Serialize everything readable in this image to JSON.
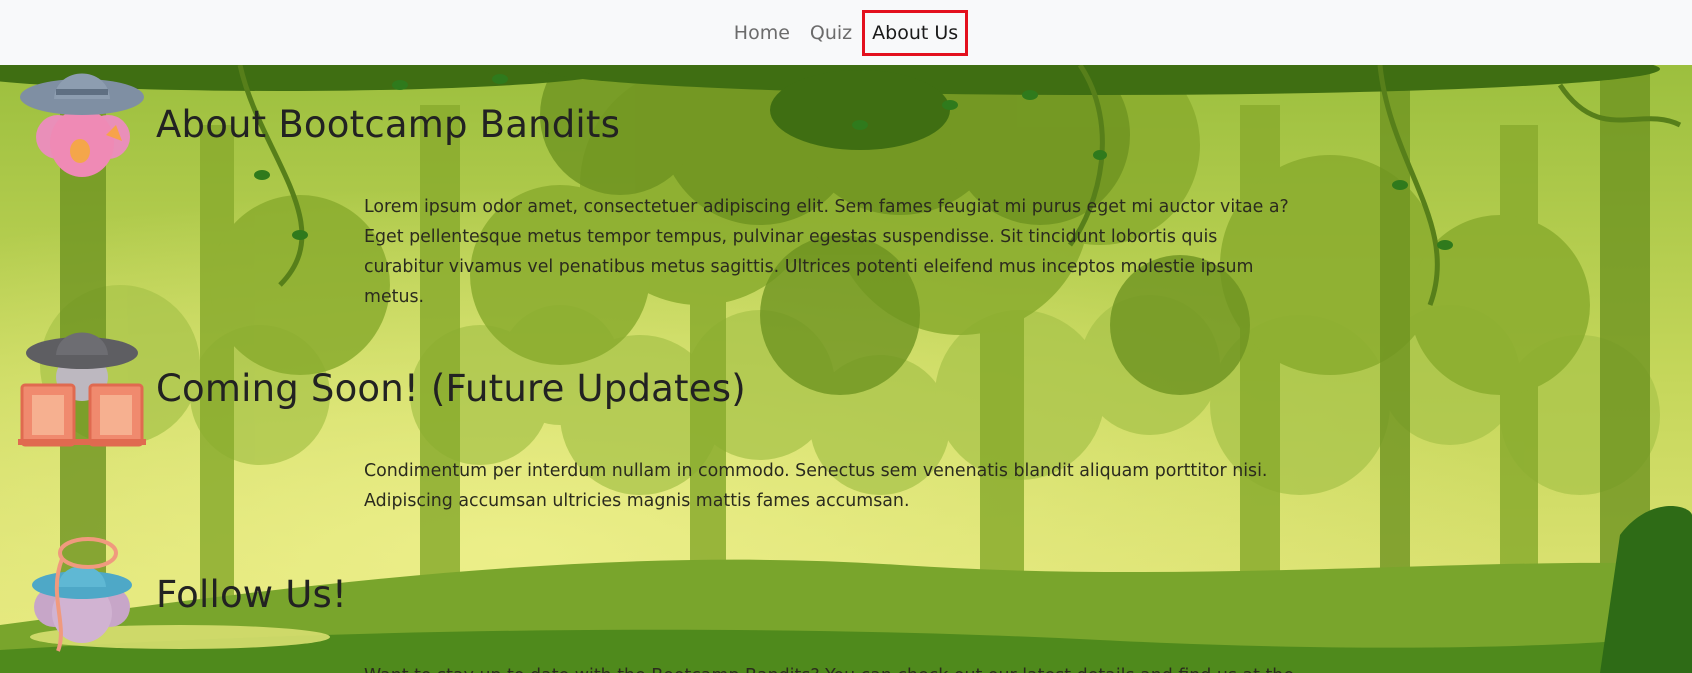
{
  "nav": {
    "items": [
      {
        "label": "Home",
        "active": false
      },
      {
        "label": "Quiz",
        "active": false
      },
      {
        "label": "About Us",
        "active": true
      }
    ]
  },
  "sections": [
    {
      "title": "About Bootcamp Bandits",
      "body": "Lorem ipsum odor amet, consectetuer adipiscing elit. Sem fames feugiat mi purus eget mi auctor vitae a? Eget pellentesque metus tempor tempus, pulvinar egestas suspendisse. Sit tincidunt lobortis quis curabitur vivamus vel penatibus metus sagittis. Ultrices potenti eleifend mus inceptos molestie ipsum metus.",
      "avatar": "bandit-cowboy-hat-icon"
    },
    {
      "title": "Coming Soon! (Future Updates)",
      "body": "Condimentum per interdum nullam in commodo. Senectus sem venenatis blandit aliquam porttitor nisi. Adipiscing accumsan ultricies magnis mattis fames accumsan.",
      "avatar": "bandit-saloon-doors-icon"
    },
    {
      "title": "Follow Us!",
      "body": "Want to stay up to date with the Bootcamp Bandits? You can check out our latest details and find us at the",
      "avatar": "bandit-lasso-icon"
    }
  ],
  "colors": {
    "navbar_bg": "#f8f9fa",
    "active_outline": "#e3101d",
    "jungle_dark": "#4e7a14",
    "jungle_light": "#d6df6a"
  }
}
